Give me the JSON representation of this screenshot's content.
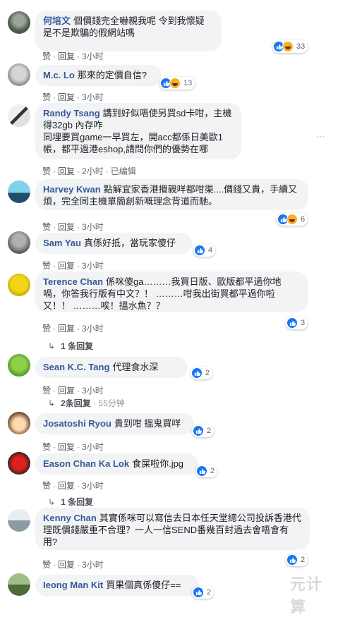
{
  "ui": {
    "like": "赞",
    "reply": "回复",
    "sep": "·",
    "edited": "已编辑",
    "watermark": "元计算"
  },
  "colors": {
    "name": "#385898",
    "bubble": "#f2f3f5",
    "like_blue": "#1877f2",
    "haha_yellow": "#f7b125"
  },
  "comments": [
    {
      "name": "何培文",
      "text": "個價錢完全嚇親我呢 令到我懷疑是不是欺騙的假網站嗎",
      "time": "3小时",
      "reactions": [
        "like",
        "haha"
      ],
      "count": "33"
    },
    {
      "name": "M.c. Lo",
      "text": "那來的定價自信?",
      "time": "3小时",
      "reactions": [
        "like",
        "haha"
      ],
      "count": "13"
    },
    {
      "name": "Randy Tsang",
      "text": "講到好似唔使另買sd卡咁，主機得32gb 內存咋",
      "text2": "同埋要買game一早買左，開acc都係日美歐1帳，都平過港eshop,請問你們的優勢在哪",
      "time": "2小时",
      "edited": true
    },
    {
      "name": "Harvey Kwan",
      "text": "點解宜家香港攪親咩都咁渠....價錢又貴，手續又煩，完全同主機單簡創新嘅理念背道而馳。",
      "time": "3小时",
      "reactions": [
        "like",
        "haha"
      ],
      "count": "6"
    },
    {
      "name": "Sam Yau",
      "text": "真係好抵，當玩家傻仔",
      "time": "3小时",
      "reactions": [
        "like"
      ],
      "count": "4"
    },
    {
      "name": "Terence Chan",
      "text": "係咪傻ga………我買日版、歐版都平過你地喎，你答我行版有中文？！ ………咁我出街買都平過你啦又！！ ………唉！搵水魚？？",
      "time": "3小时",
      "reactions": [
        "like"
      ],
      "count": "3",
      "replies": "1 条回复"
    },
    {
      "name": "Sean K.C. Tang",
      "text": "代理食水深",
      "time": "3小时",
      "reactions": [
        "like"
      ],
      "count": "2",
      "replies": "2条回复",
      "reply_time": "55分钟"
    },
    {
      "name": "Josatoshi Ryou",
      "text": "貴到咁 搵鬼買咩",
      "time": "3小时",
      "reactions": [
        "like"
      ],
      "count": "2"
    },
    {
      "name": "Eason Chan Ka Lok",
      "text": "食屎啦你.jpg",
      "time": "3小时",
      "reactions": [
        "like"
      ],
      "count": "2",
      "replies": "1 条回复"
    },
    {
      "name": "Kenny Chan",
      "text": "其實係咪可以寫信去日本任天堂總公司投訴香港代理既價錢嚴重不合理？一人一信SEND番幾百封過去會唔會有用?",
      "time": "3小时",
      "reactions": [
        "like"
      ],
      "count": "2"
    },
    {
      "name": "Ieong Man Kit",
      "text": "買果個真係傻仔==",
      "reactions": [
        "like"
      ],
      "count": "2"
    }
  ]
}
